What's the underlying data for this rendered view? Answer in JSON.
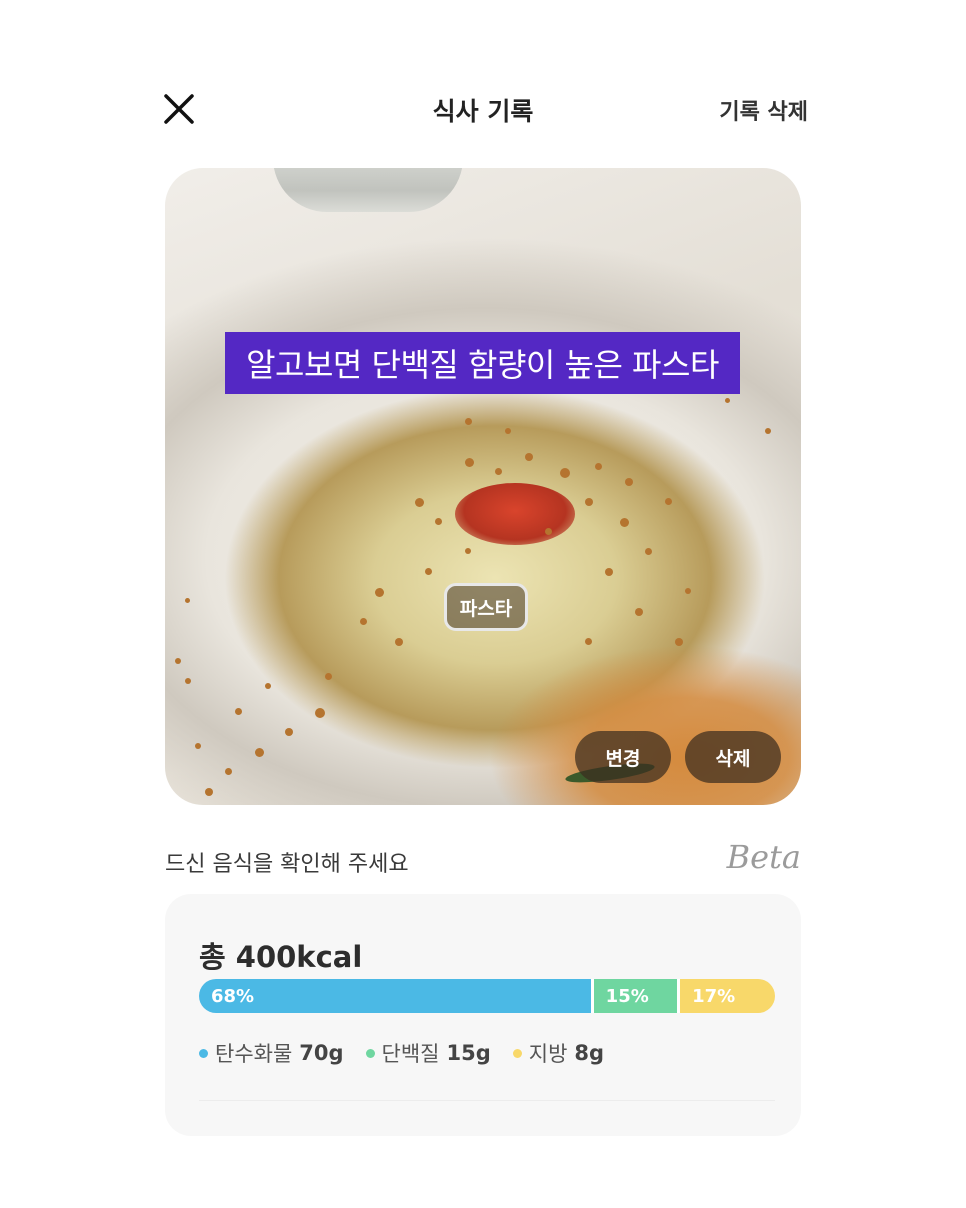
{
  "header": {
    "title": "식사 기록",
    "delete_record_label": "기록 삭제",
    "close_icon": "close-icon"
  },
  "photo": {
    "headline": "알고보면 단백질 함량이 높은 파스타",
    "food_tag": "파스타",
    "change_label": "변경",
    "delete_label": "삭제"
  },
  "section": {
    "confirm_text": "드신 음식을 확인해 주세요",
    "beta_label": "Beta"
  },
  "nutrition": {
    "total_text": "총 400kcal",
    "macros": [
      {
        "label": "탄수화물",
        "amount": "70g",
        "percent_text": "68%",
        "percent": 68,
        "color": "#4bb9e5"
      },
      {
        "label": "단백질",
        "amount": "15g",
        "percent_text": "15%",
        "percent": 15,
        "color": "#6fd6a0"
      },
      {
        "label": "지방",
        "amount": "8g",
        "percent_text": "17%",
        "percent": 17,
        "color": "#f8d86a"
      }
    ]
  }
}
